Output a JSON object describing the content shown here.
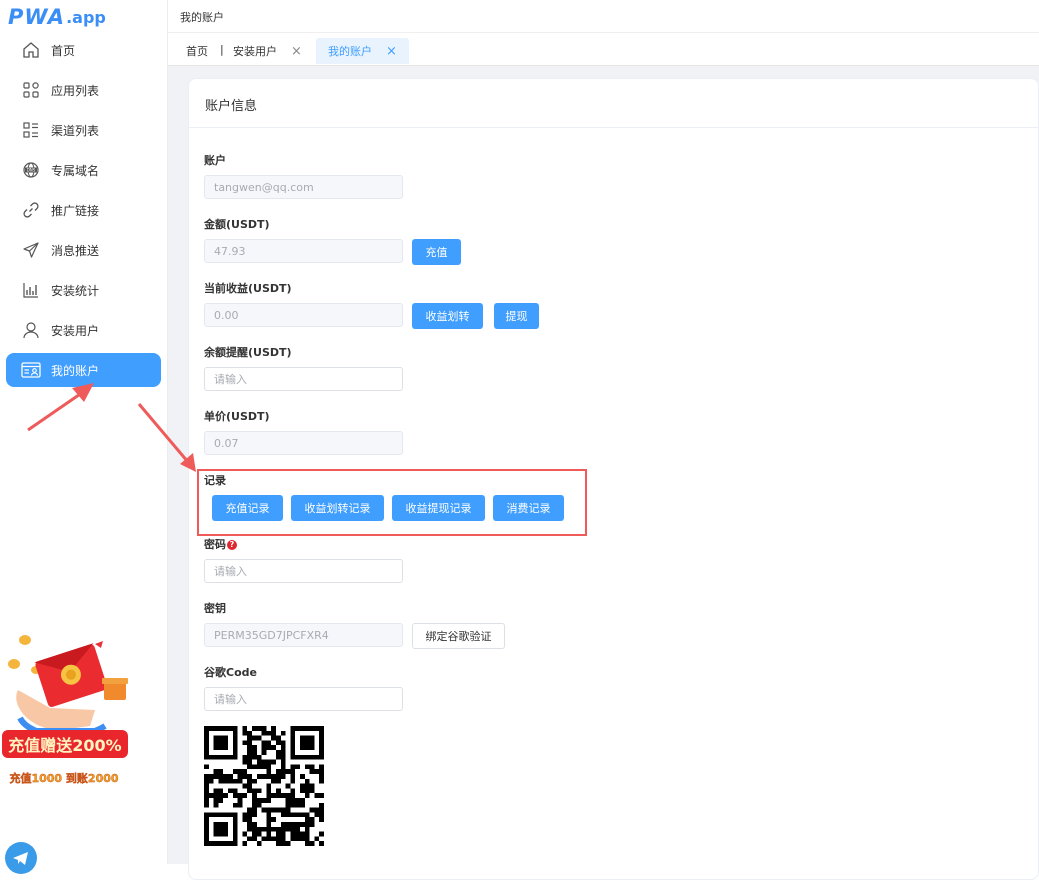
{
  "app": {
    "logo_main": "PWA",
    "logo_ext": ".app"
  },
  "sidebar": {
    "items": [
      {
        "label": "首页",
        "icon": "home-icon"
      },
      {
        "label": "应用列表",
        "icon": "apps-grid-icon"
      },
      {
        "label": "渠道列表",
        "icon": "channel-list-icon"
      },
      {
        "label": "专属域名",
        "icon": "dns-globe-icon"
      },
      {
        "label": "推广链接",
        "icon": "link-icon"
      },
      {
        "label": "消息推送",
        "icon": "send-icon"
      },
      {
        "label": "安装统计",
        "icon": "chart-icon"
      },
      {
        "label": "安装用户",
        "icon": "user-icon"
      },
      {
        "label": "我的账户",
        "icon": "account-card-icon",
        "active": true
      }
    ],
    "promo": {
      "headline": "充值赠送200%",
      "sub": "充值1000 到账2000"
    }
  },
  "topbar": {
    "title": "我的账户"
  },
  "tabs": {
    "home": "首页",
    "separator": "|",
    "install_users": "安装用户",
    "my_account": "我的账户",
    "close_glyph": "×"
  },
  "card": {
    "title": "账户信息"
  },
  "form": {
    "account": {
      "label": "账户",
      "value": "tangwen@qq.com"
    },
    "amount": {
      "label": "金额(USDT)",
      "value": "47.93",
      "button": "充值"
    },
    "earnings": {
      "label": "当前收益(USDT)",
      "value": "0.00",
      "transfer_button": "收益划转",
      "withdraw_button": "提现"
    },
    "balance_alert": {
      "label": "余额提醒(USDT)",
      "placeholder": "请输入"
    },
    "unit_price": {
      "label": "单价(USDT)",
      "value": "0.07"
    },
    "records": {
      "label": "记录",
      "buttons": [
        "充值记录",
        "收益划转记录",
        "收益提现记录",
        "消费记录"
      ]
    },
    "password": {
      "label": "密码",
      "help": "?",
      "placeholder": "请输入"
    },
    "secret_key": {
      "label": "密钥",
      "value": "PERM35GD7JPCFXR4",
      "button": "绑定谷歌验证"
    },
    "google_code": {
      "label": "谷歌Code",
      "placeholder": "请输入"
    }
  },
  "colors": {
    "primary": "#409eff",
    "highlight_box": "#ef5a5a",
    "page_bg": "#f0f2f5"
  }
}
